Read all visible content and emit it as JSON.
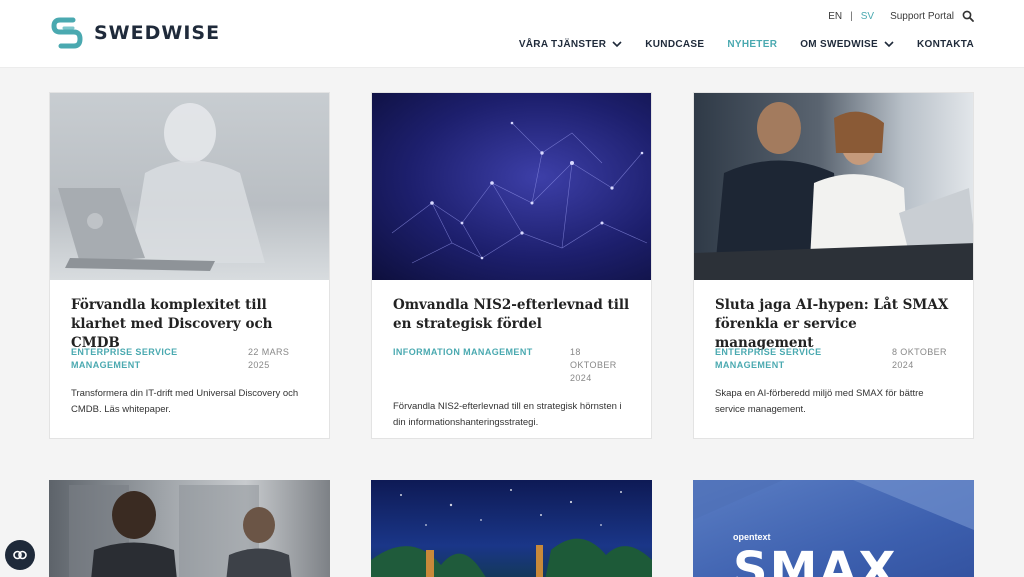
{
  "brand": {
    "name": "SWEDWISE",
    "accent": "#4aa9b0"
  },
  "utility": {
    "lang_en": "EN",
    "lang_sv": "SV",
    "separator": "|",
    "support": "Support Portal"
  },
  "nav": {
    "items": [
      {
        "label": "VÅRA TJÄNSTER"
      },
      {
        "label": "KUNDCASE"
      },
      {
        "label": "NYHETER"
      },
      {
        "label": "OM SWEDWISE"
      },
      {
        "label": "KONTAKTA"
      }
    ],
    "active": "NYHETER"
  },
  "articles": [
    {
      "title": "Förvandla komplexitet till klarhet med Discovery och CMDB",
      "category": "ENTERPRISE SERVICE MANAGEMENT",
      "date": "22 MARS 2025",
      "excerpt": "Transformera din IT-drift med Universal Discovery och CMDB. Läs whitepaper."
    },
    {
      "title": "Omvandla NIS2-efterlevnad till en strategisk fördel",
      "category": "INFORMATION MANAGEMENT",
      "date": "18 OKTOBER 2024",
      "excerpt": "Förvandla NIS2-efterlevnad till en strategisk hörnsten i din informationshanteringsstrategi."
    },
    {
      "title": "Sluta jaga AI-hypen: Låt SMAX förenkla er service management",
      "category": "ENTERPRISE SERVICE MANAGEMENT",
      "date": "8 OKTOBER 2024",
      "excerpt": "Skapa en AI-förberedd miljö med SMAX för bättre service management."
    }
  ],
  "next_row": {
    "smax_brand": "opentext",
    "smax_text": "SMAX"
  }
}
